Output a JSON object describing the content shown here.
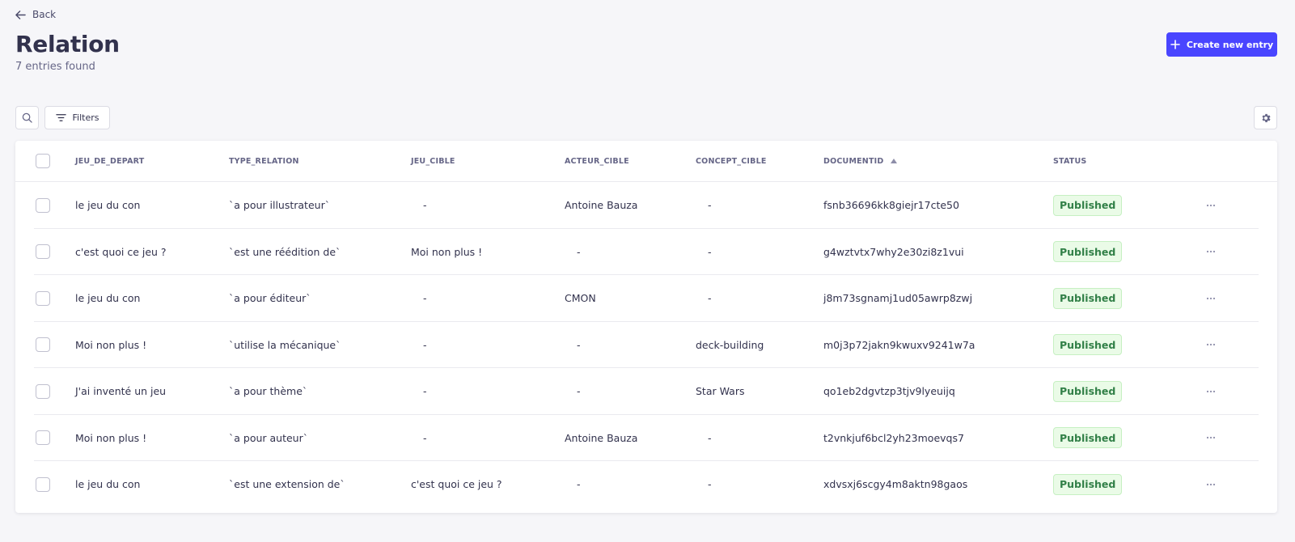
{
  "nav": {
    "back_label": "Back"
  },
  "header": {
    "title": "Relation",
    "subtitle": "7 entries found",
    "create_label": "Create new entry"
  },
  "toolbar": {
    "filters_label": "Filters"
  },
  "table": {
    "columns": [
      "JEU_DE_DEPART",
      "TYPE_RELATION",
      "JEU_CIBLE",
      "ACTEUR_CIBLE",
      "CONCEPT_CIBLE",
      "DOCUMENTID",
      "STATUS"
    ],
    "sorted_column": "DOCUMENTID",
    "sort_direction": "ascending",
    "rows": [
      [
        "le jeu du con",
        "`a pour illustrateur`",
        "-",
        "Antoine Bauza",
        "-",
        "fsnb36696kk8giejr17cte50",
        "Published"
      ],
      [
        "c'est quoi ce jeu ?",
        "`est une réédition de`",
        "Moi non plus !",
        "-",
        "-",
        "g4wztvtx7why2e30zi8z1vui",
        "Published"
      ],
      [
        "le jeu du con",
        "`a pour éditeur`",
        "-",
        "CMON",
        "-",
        "j8m73sgnamj1ud05awrp8zwj",
        "Published"
      ],
      [
        "Moi non plus !",
        "`utilise la mécanique`",
        "-",
        "-",
        "deck-building",
        "m0j3p72jakn9kwuxv9241w7a",
        "Published"
      ],
      [
        "J'ai inventé un jeu",
        "`a pour thème`",
        "-",
        "-",
        "Star Wars",
        "qo1eb2dgvtzp3tjv9lyeuijq",
        "Published"
      ],
      [
        "Moi non plus !",
        "`a pour auteur`",
        "-",
        "Antoine Bauza",
        "-",
        "t2vnkjuf6bcl2yh23moevqs7",
        "Published"
      ],
      [
        "le jeu du con",
        "`est une extension de`",
        "c'est quoi ce jeu ?",
        "-",
        "-",
        "xdvsxj6scgy4m8aktn98gaos",
        "Published"
      ]
    ]
  },
  "icons": {
    "back": "arrow-left-icon",
    "create": "plus-icon",
    "search": "search-icon",
    "filters": "filter-icon",
    "settings": "gear-icon",
    "sort": "caret-up-icon",
    "row_actions": "more-horizontal-icon"
  },
  "colors": {
    "primary": "#4945ff",
    "published_bg": "#eafbe7",
    "published_border": "#c6f0c2",
    "published_text": "#328048",
    "page_bg": "#f6f6f9"
  }
}
